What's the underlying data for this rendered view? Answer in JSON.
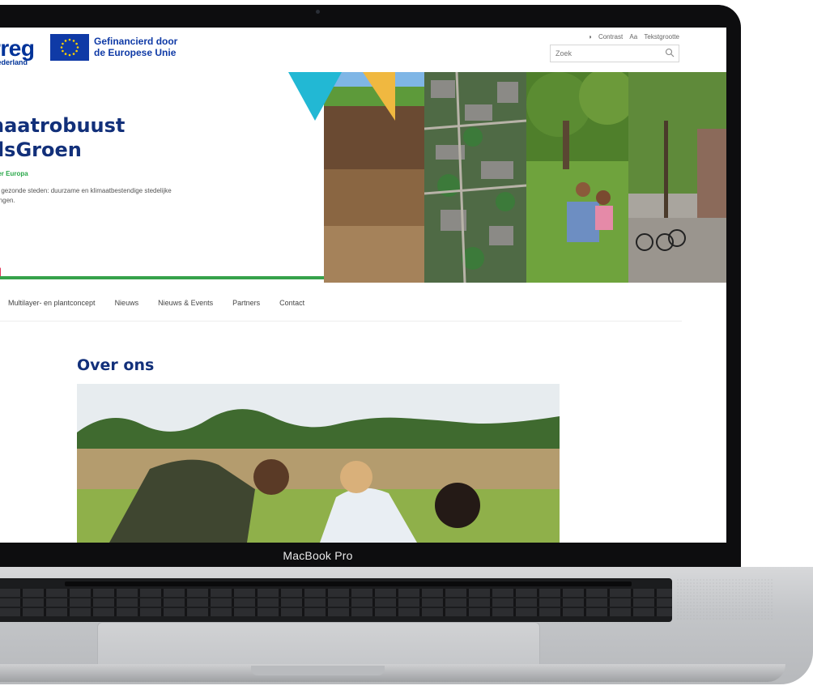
{
  "device": {
    "label": "MacBook Pro"
  },
  "site": {
    "logo": {
      "brand": "rreg",
      "region": "Nederland"
    },
    "eu_badge": {
      "line1": "Gefinancierd door",
      "line2": "de Europese Unie"
    },
    "utility": {
      "contrast": "Contrast",
      "text_size": "Tekstgrootte"
    },
    "search": {
      "placeholder": "Zoek"
    },
    "hero": {
      "title_line1": "naatrobuust",
      "title_line2": "dsGroen",
      "subtitle": "ener Europa",
      "desc_line1": "en, gezonde steden: duurzame en klimaatbestendige stedelijke",
      "desc_line2": "eningen."
    },
    "nav": [
      "Multilayer- en plantconcept",
      "Nieuws",
      "Nieuws & Events",
      "Partners",
      "Contact"
    ],
    "about": {
      "title": "Over ons"
    }
  },
  "colors": {
    "navy": "#12307a",
    "green": "#36a24b",
    "cyan": "#22b8d4",
    "yellow": "#f0b840",
    "pink": "#e0365b"
  }
}
